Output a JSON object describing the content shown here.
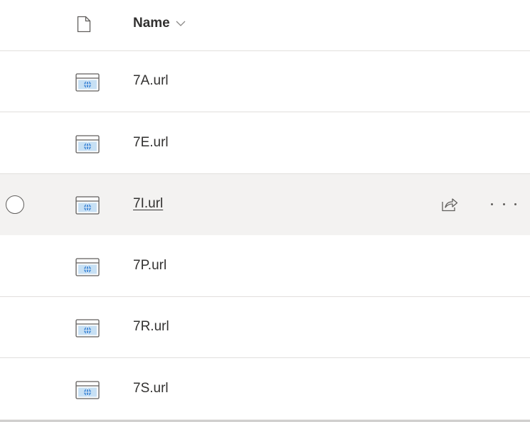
{
  "header": {
    "type_icon": "document-icon",
    "name_label": "Name",
    "sort_icon": "chevron-down-icon"
  },
  "files": [
    {
      "name": "7A.url",
      "icon": "url-file-icon"
    },
    {
      "name": "7E.url",
      "icon": "url-file-icon"
    },
    {
      "name": "7I.url",
      "icon": "url-file-icon",
      "hovered": true
    },
    {
      "name": "7P.url",
      "icon": "url-file-icon"
    },
    {
      "name": "7R.url",
      "icon": "url-file-icon"
    },
    {
      "name": "7S.url",
      "icon": "url-file-icon"
    }
  ],
  "row_actions": {
    "share_icon": "share-icon",
    "more_icon": "more-options-icon"
  },
  "colors": {
    "link_icon_accent": "#4a8fd8",
    "hover_background": "#f3f2f1",
    "divider": "#e1dfdd"
  }
}
